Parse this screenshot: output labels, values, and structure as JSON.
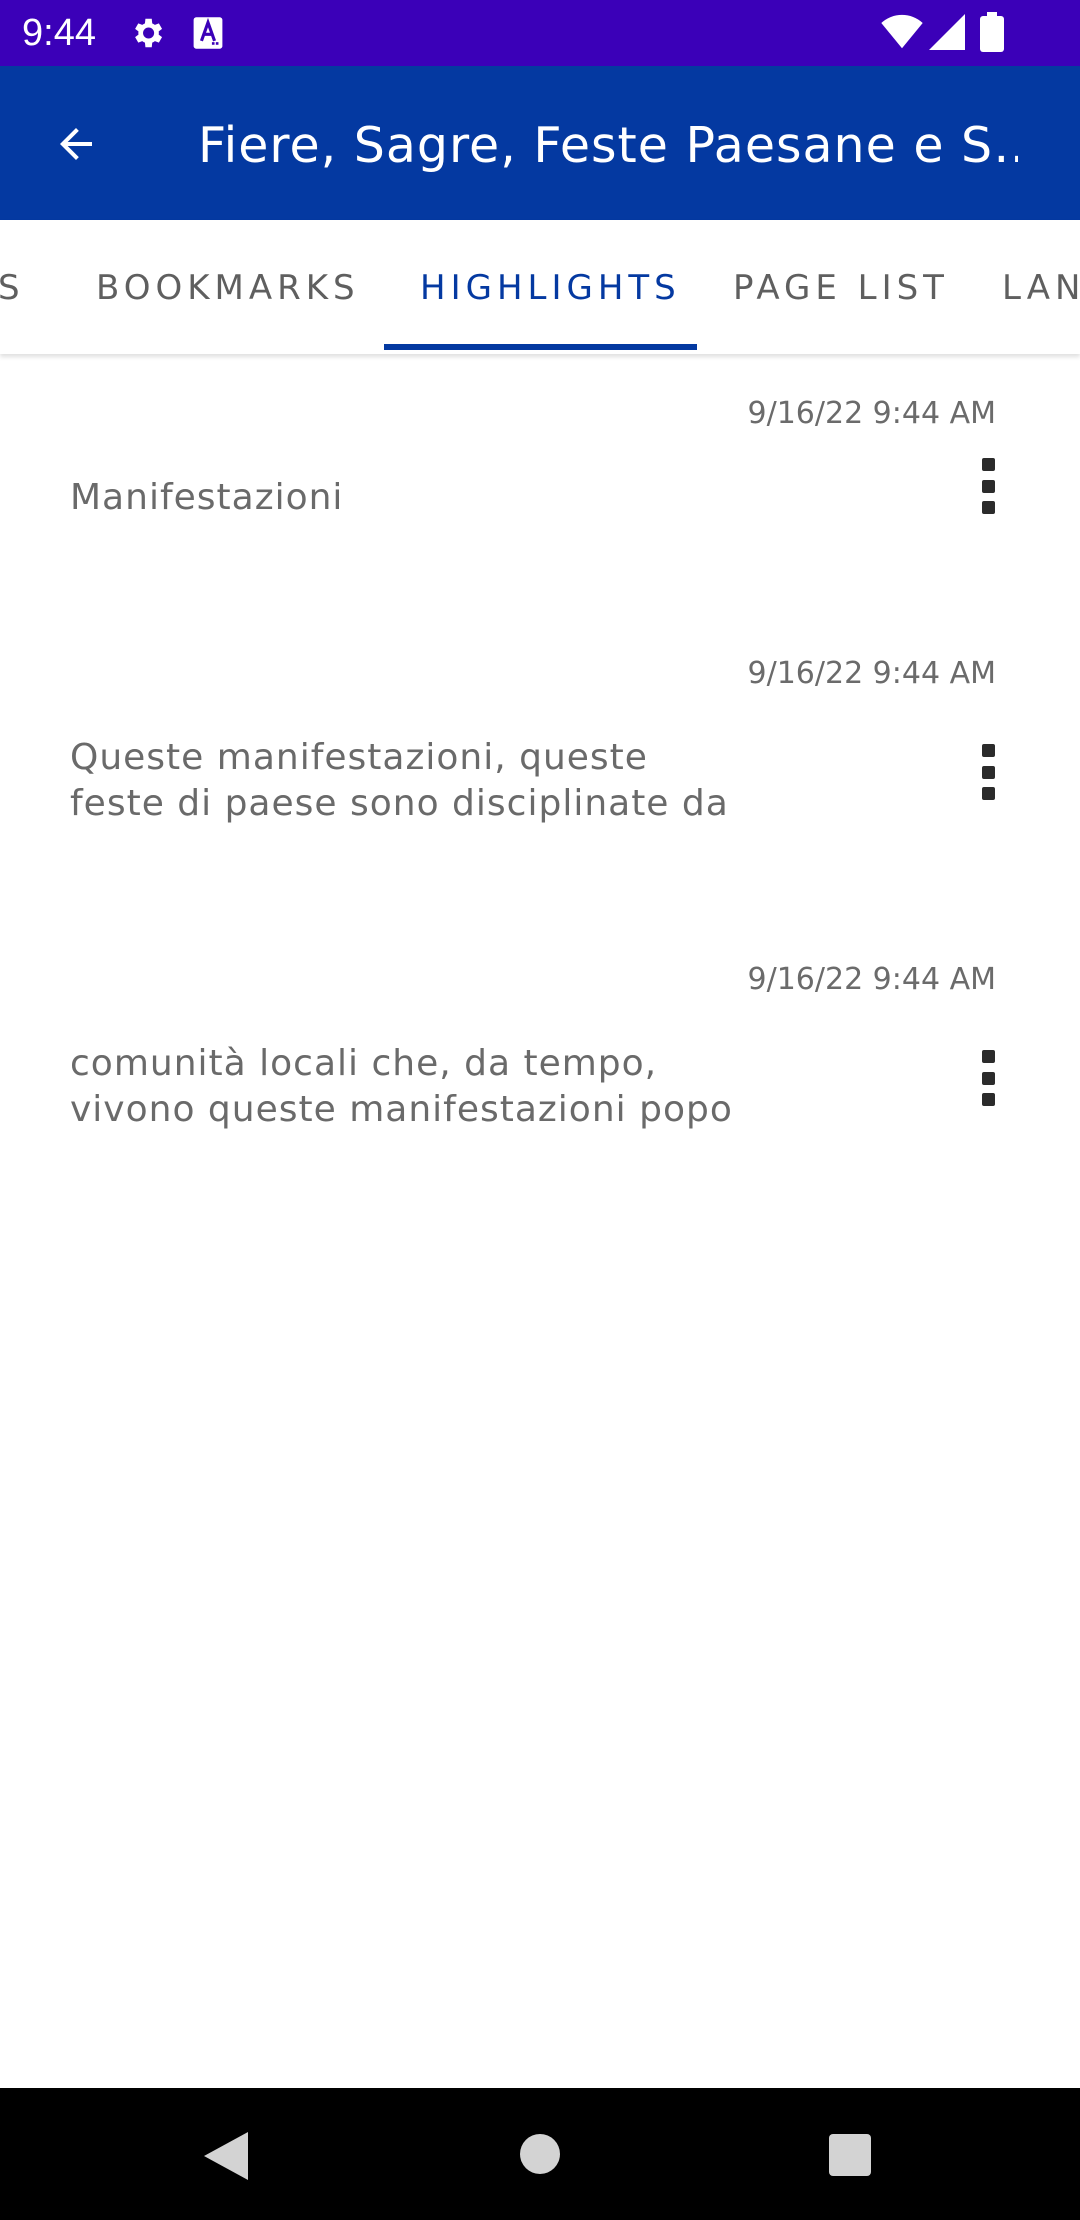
{
  "status_bar": {
    "time": "9:44",
    "icons": [
      "gear-icon",
      "text-a-icon",
      "wifi-icon",
      "signal-icon",
      "battery-icon"
    ],
    "background": "#3b00b8"
  },
  "app_bar": {
    "title": "Fiere, Sagre, Feste Paesane e S…",
    "back_icon": "arrow-left-icon",
    "background": "#0439a1"
  },
  "tabs": [
    {
      "label": "S",
      "active": false
    },
    {
      "label": "BOOKMARKS",
      "active": false
    },
    {
      "label": "HIGHLIGHTS",
      "active": true
    },
    {
      "label": "PAGE LIST",
      "active": false
    },
    {
      "label": "LAN",
      "active": false
    }
  ],
  "highlights": [
    {
      "date": "9/16/22 9:44 AM",
      "lines": [
        "Manifestazioni"
      ],
      "more_icon": "more-vertical-icon"
    },
    {
      "date": "9/16/22 9:44 AM",
      "lines": [
        "Queste manifestazioni, queste",
        "feste di paese sono disciplinate da …"
      ],
      "more_icon": "more-vertical-icon"
    },
    {
      "date": "9/16/22 9:44 AM",
      "lines": [
        "comunità locali che, da tempo,",
        "vivono queste manifestazioni popol…"
      ],
      "more_icon": "more-vertical-icon"
    }
  ],
  "nav_bar": {
    "icons": [
      "nav-back-icon",
      "nav-home-icon",
      "nav-recents-icon"
    ]
  },
  "colors": {
    "accent": "#0439a1",
    "text_secondary": "#6a6a6a"
  }
}
